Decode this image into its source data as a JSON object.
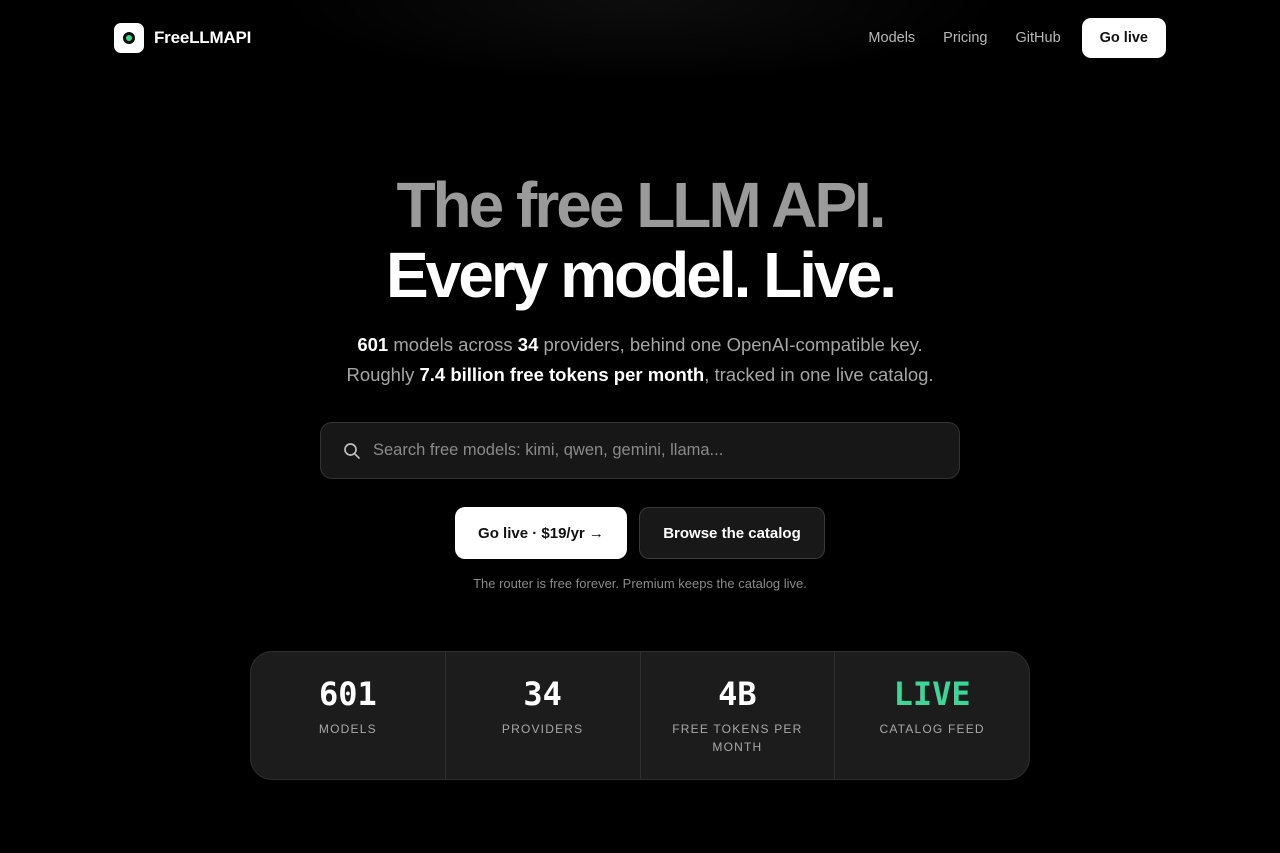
{
  "nav": {
    "brand": "FreeLLMAPI",
    "links": [
      "Models",
      "Pricing",
      "GitHub"
    ],
    "cta": "Go live"
  },
  "hero": {
    "line1": "The free LLM API.",
    "line2": "Every model. Live."
  },
  "subtitle": {
    "models_count": "601",
    "text1": " models across ",
    "providers_count": "34",
    "text2": " providers, behind one OpenAI-compatible key.",
    "text3": "Roughly ",
    "tokens": "7.4 billion free tokens per month",
    "text4": ", tracked in one live catalog."
  },
  "search": {
    "placeholder": "Search free models: kimi, qwen, gemini, llama..."
  },
  "buttons": {
    "primary": "Go live · $19/yr →",
    "secondary": "Browse the catalog"
  },
  "note": "The router is free forever. Premium keeps the catalog live.",
  "stats": [
    {
      "value": "601",
      "label": "MODELS"
    },
    {
      "value": "34",
      "label": "PROVIDERS"
    },
    {
      "value": "4B",
      "label": "FREE TOKENS PER MONTH"
    },
    {
      "value": "LIVE",
      "label": "CATALOG FEED"
    }
  ],
  "colors": {
    "background": "#000000",
    "accent_live": "#3ed598",
    "hero_muted": "#9a9a9a"
  }
}
